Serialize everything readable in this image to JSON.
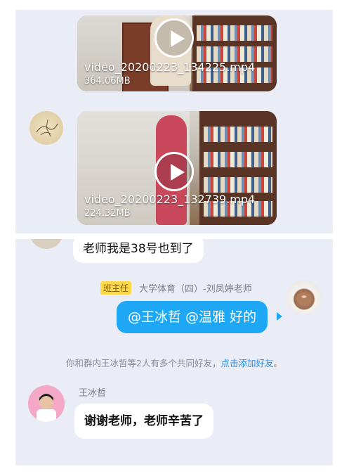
{
  "videos": [
    {
      "filename": "video_20200223_134225.mp4",
      "size": "364.06MB"
    },
    {
      "filename": "video_20200223_132739.mp4",
      "size": "224.32MB"
    }
  ],
  "messages": {
    "msg_38": "老师我是38号也到了",
    "teacher": {
      "badge": "班主任",
      "name": "大学体育（四）-刘凤婷老师",
      "text": "@王冰哲 @温雅 好的"
    },
    "system": {
      "prefix": "你和群内王冰哲等2人有多个共同好友，",
      "link": "点击添加好友",
      "suffix": "。"
    },
    "wang": {
      "name": "王冰哲",
      "text": "谢谢老师，老师辛苦了"
    }
  },
  "colors": {
    "panel_bg": "#eaedf5",
    "outgoing_bubble": "#1ea7f5",
    "link": "#2b8ee6",
    "badge": "#ffd84a"
  }
}
